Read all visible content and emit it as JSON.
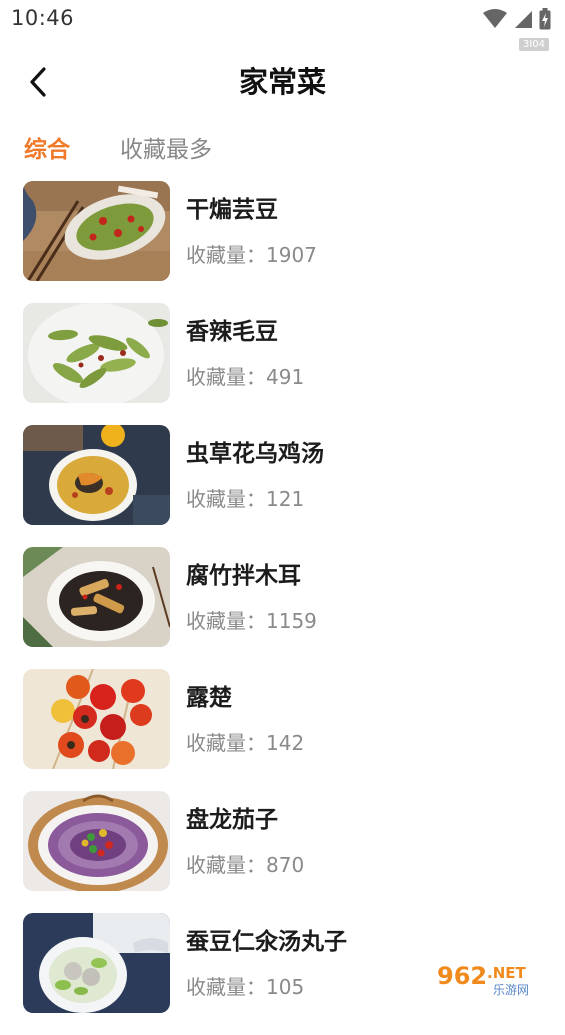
{
  "status_bar": {
    "time": "10:46",
    "tag": "3I04"
  },
  "header": {
    "title": "家常菜"
  },
  "tabs": [
    {
      "label": "综合",
      "active": true
    },
    {
      "label": "收藏最多",
      "active": false
    }
  ],
  "recipes": [
    {
      "name": "干煸芸豆",
      "favorites": "收藏量：1907"
    },
    {
      "name": "香辣毛豆",
      "favorites": "收藏量：491"
    },
    {
      "name": "虫草花乌鸡汤",
      "favorites": "收藏量：121"
    },
    {
      "name": "腐竹拌木耳",
      "favorites": "收藏量：1159"
    },
    {
      "name": "露楚",
      "favorites": "收藏量：142"
    },
    {
      "name": "盘龙茄子",
      "favorites": "收藏量：870"
    },
    {
      "name": "蚕豆仁氽汤丸子",
      "favorites": "收藏量：105"
    }
  ],
  "watermark": {
    "brand": "962.NET",
    "caption": "乐游网"
  },
  "colors": {
    "accent": "#f07a2a"
  }
}
